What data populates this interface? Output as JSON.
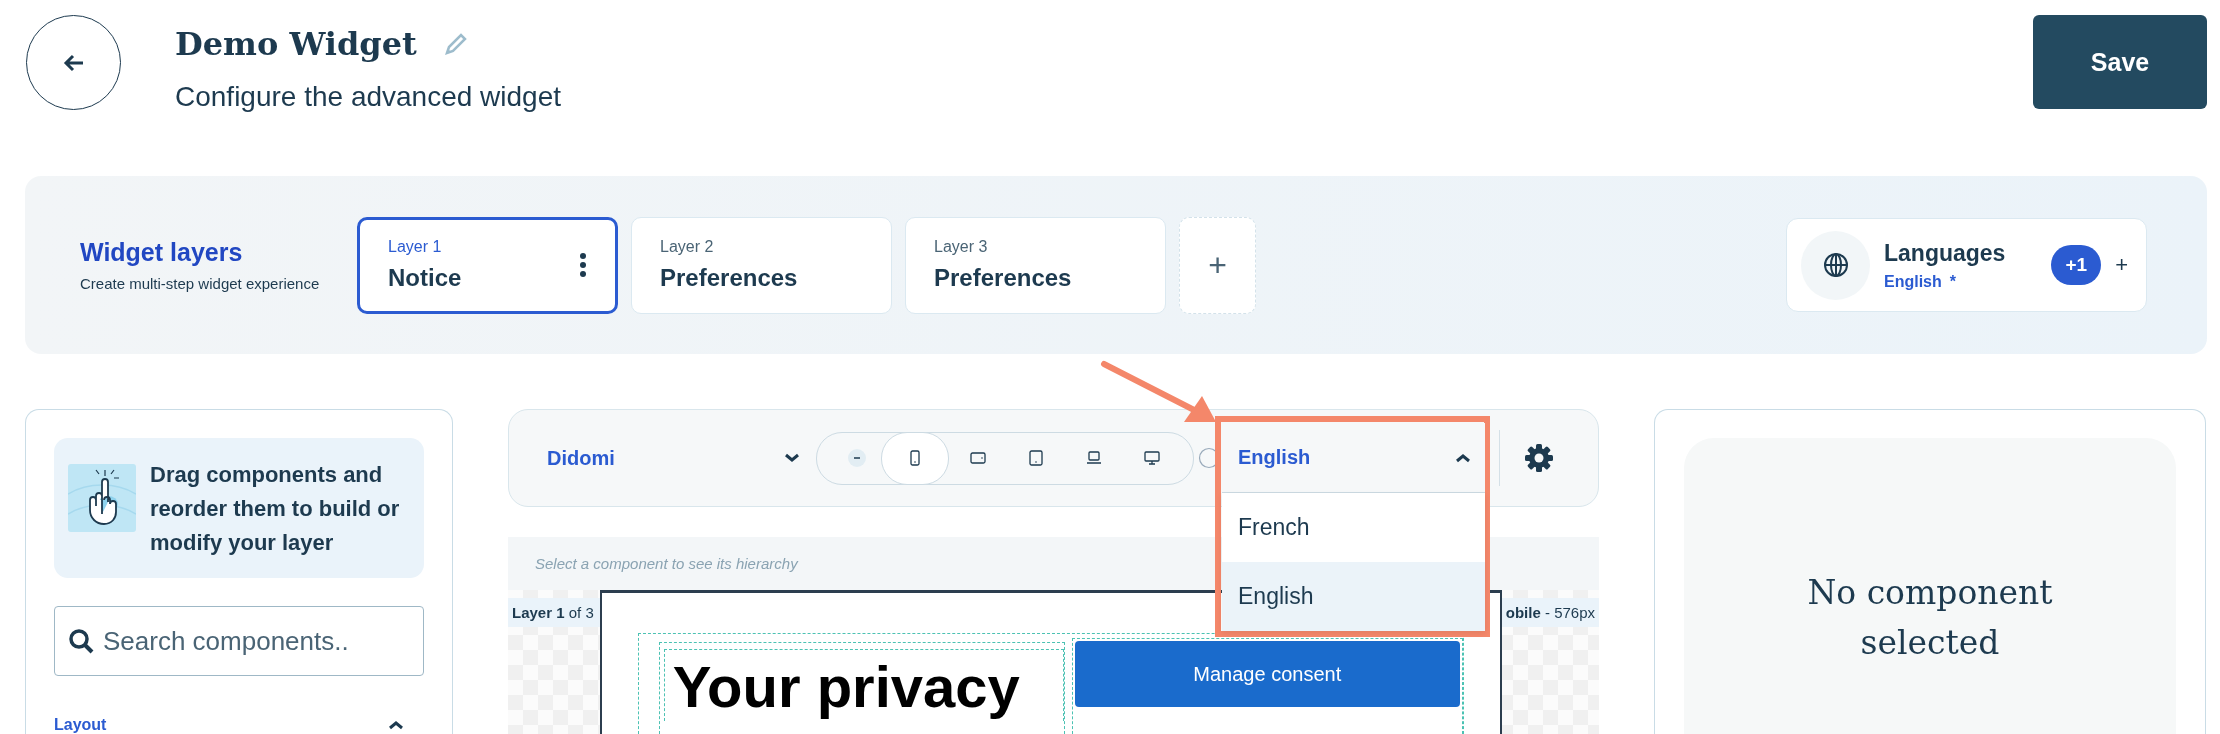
{
  "header": {
    "title": "Demo Widget",
    "subtitle": "Configure the advanced widget",
    "save": "Save"
  },
  "layers": {
    "title": "Widget layers",
    "subtitle": "Create multi-step widget experience",
    "add": "+",
    "items": [
      {
        "label": "Layer 1",
        "name": "Notice",
        "selected": true
      },
      {
        "label": "Layer 2",
        "name": "Preferences",
        "selected": false
      },
      {
        "label": "Layer 3",
        "name": "Preferences",
        "selected": false
      }
    ]
  },
  "languages": {
    "title": "Languages",
    "default": "English",
    "required_mark": "*",
    "extra_count": "+1",
    "add": "+"
  },
  "components": {
    "tip": "Drag components and reorder them to build or modify your layer",
    "search_placeholder": "Search components..",
    "section": {
      "label": "Layout",
      "expanded": true
    }
  },
  "toolbar": {
    "theme": "Didomi",
    "devices": [
      {
        "kind": "collapse",
        "selected": false
      },
      {
        "kind": "mobile",
        "selected": true
      },
      {
        "kind": "tablet-landscape",
        "selected": false
      },
      {
        "kind": "tablet",
        "selected": false
      },
      {
        "kind": "laptop",
        "selected": false
      },
      {
        "kind": "desktop",
        "selected": false
      }
    ],
    "language": {
      "value": "English",
      "expanded": true,
      "options": [
        {
          "label": "French",
          "selected": false
        },
        {
          "label": "English",
          "selected": true
        }
      ]
    }
  },
  "canvas": {
    "hint": "Select a component to see its hierarchy",
    "layer_info": "**Layer 1** of 3",
    "device_info": "**obile** - 576px",
    "preview": {
      "heading": "Your privacy",
      "button": "Manage consent"
    }
  },
  "inspector": {
    "empty": "No component selected"
  }
}
